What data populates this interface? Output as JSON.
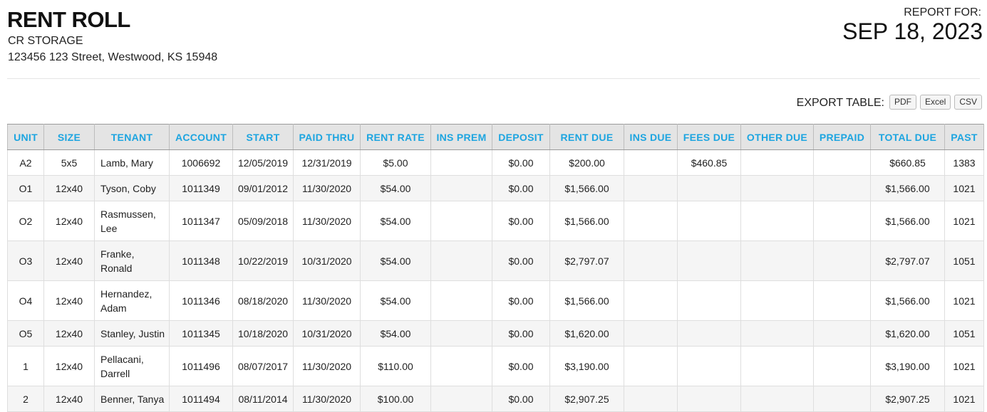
{
  "header": {
    "title": "RENT ROLL",
    "company": "CR STORAGE",
    "address": "123456 123 Street, Westwood, KS 15948",
    "report_for_label": "REPORT FOR:",
    "report_date": "SEP 18, 2023"
  },
  "export": {
    "label": "EXPORT TABLE:",
    "pdf": "PDF",
    "excel": "Excel",
    "csv": "CSV"
  },
  "table": {
    "columns": [
      "UNIT",
      "SIZE",
      "TENANT",
      "ACCOUNT",
      "START",
      "PAID THRU",
      "RENT RATE",
      "INS PREM",
      "DEPOSIT",
      "RENT DUE",
      "INS DUE",
      "FEES DUE",
      "OTHER DUE",
      "PREPAID",
      "TOTAL DUE",
      "PAST"
    ],
    "rows": [
      [
        "A2",
        "5x5",
        "Lamb, Mary",
        "1006692",
        "12/05/2019",
        "12/31/2019",
        "$5.00",
        "",
        "$0.00",
        "$200.00",
        "",
        "$460.85",
        "",
        "",
        "$660.85",
        "1383"
      ],
      [
        "O1",
        "12x40",
        "Tyson, Coby",
        "1011349",
        "09/01/2012",
        "11/30/2020",
        "$54.00",
        "",
        "$0.00",
        "$1,566.00",
        "",
        "",
        "",
        "",
        "$1,566.00",
        "1021"
      ],
      [
        "O2",
        "12x40",
        "Rasmussen, Lee",
        "1011347",
        "05/09/2018",
        "11/30/2020",
        "$54.00",
        "",
        "$0.00",
        "$1,566.00",
        "",
        "",
        "",
        "",
        "$1,566.00",
        "1021"
      ],
      [
        "O3",
        "12x40",
        "Franke, Ronald",
        "1011348",
        "10/22/2019",
        "10/31/2020",
        "$54.00",
        "",
        "$0.00",
        "$2,797.07",
        "",
        "",
        "",
        "",
        "$2,797.07",
        "1051"
      ],
      [
        "O4",
        "12x40",
        "Hernandez, Adam",
        "1011346",
        "08/18/2020",
        "11/30/2020",
        "$54.00",
        "",
        "$0.00",
        "$1,566.00",
        "",
        "",
        "",
        "",
        "$1,566.00",
        "1021"
      ],
      [
        "O5",
        "12x40",
        "Stanley, Justin",
        "1011345",
        "10/18/2020",
        "10/31/2020",
        "$54.00",
        "",
        "$0.00",
        "$1,620.00",
        "",
        "",
        "",
        "",
        "$1,620.00",
        "1051"
      ],
      [
        "1",
        "12x40",
        "Pellacani, Darrell",
        "1011496",
        "08/07/2017",
        "11/30/2020",
        "$110.00",
        "",
        "$0.00",
        "$3,190.00",
        "",
        "",
        "",
        "",
        "$3,190.00",
        "1021"
      ],
      [
        "2",
        "12x40",
        "Benner, Tanya",
        "1011494",
        "08/11/2014",
        "11/30/2020",
        "$100.00",
        "",
        "$0.00",
        "$2,907.25",
        "",
        "",
        "",
        "",
        "$2,907.25",
        "1021"
      ]
    ]
  },
  "colors": {
    "header_text": "#1da5e0",
    "header_bg": "#e4e4e4",
    "stripe": "#f5f5f5"
  }
}
